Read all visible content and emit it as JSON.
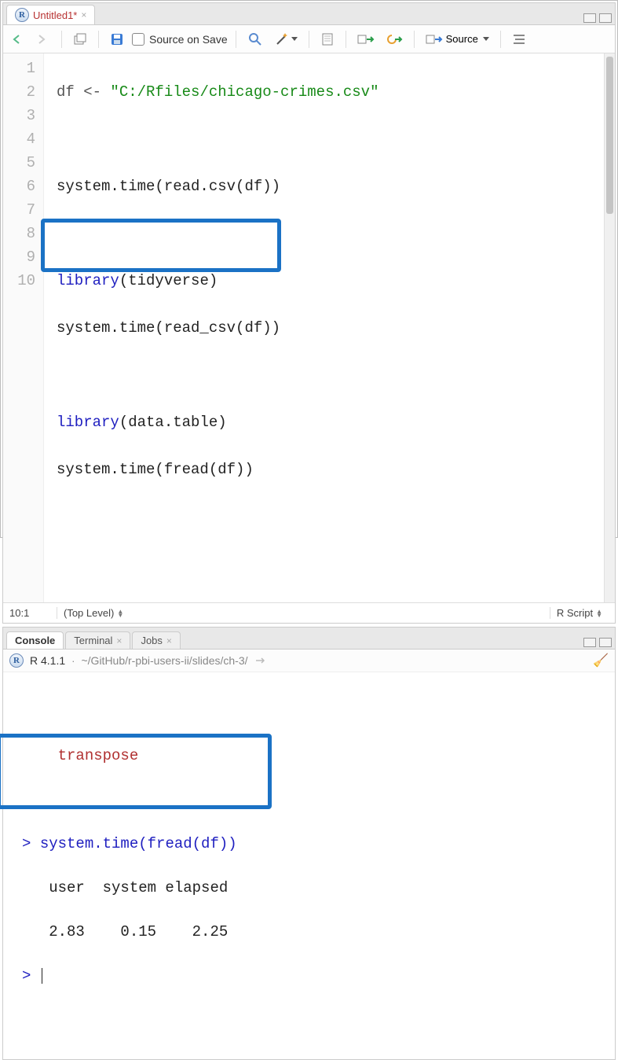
{
  "editor": {
    "tab_title": "Untitled1*",
    "toolbar": {
      "source_on_save": "Source on Save",
      "source_btn": "Source"
    },
    "lines": {
      "n1": "1",
      "n2": "2",
      "n3": "3",
      "n4": "4",
      "n5": "5",
      "n6": "6",
      "n7": "7",
      "n8": "8",
      "n9": "9",
      "n10": "10"
    },
    "code": {
      "l1_pre": "df <- ",
      "l1_str": "\"C:/Rfiles/chicago-crimes.csv\"",
      "l3": "system.time(read.csv(df))",
      "l5_kw": "library",
      "l5_rest": "(tidyverse)",
      "l6": "system.time(read_csv(df))",
      "l8_kw": "library",
      "l8_rest": "(data.table)",
      "l9": "system.time(fread(df))"
    },
    "status": {
      "pos": "10:1",
      "scope": "(Top Level)",
      "lang": "R Script"
    }
  },
  "console": {
    "tabs": {
      "console": "Console",
      "terminal": "Terminal",
      "jobs": "Jobs"
    },
    "version": "R 4.1.1",
    "path": "~/GitHub/r-pbi-users-ii/slides/ch-3/",
    "lines": {
      "transpose": "    transpose",
      "cmd": "system.time(fread(df))",
      "hdr": "   user  system elapsed ",
      "vals": "   2.83    0.15    2.25 "
    },
    "timing": {
      "user": 2.83,
      "system": 0.15,
      "elapsed": 2.25
    }
  }
}
